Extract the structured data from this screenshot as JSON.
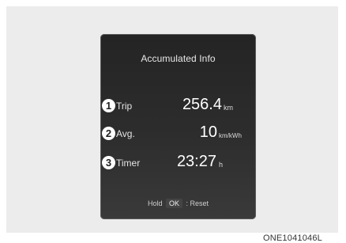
{
  "panel": {
    "title": "Accumulated Info",
    "rows": [
      {
        "badge": "1",
        "label": "Trip",
        "value": "256.4",
        "unit": "km"
      },
      {
        "badge": "2",
        "label": "Avg.",
        "value": "10",
        "unit": "km/kWh"
      },
      {
        "badge": "3",
        "label": "Timer",
        "value": "23:27",
        "unit": "h"
      }
    ],
    "footer": {
      "hold": "Hold",
      "ok": "OK",
      "reset": ": Reset"
    }
  },
  "figure_code": "ONE1041046L"
}
